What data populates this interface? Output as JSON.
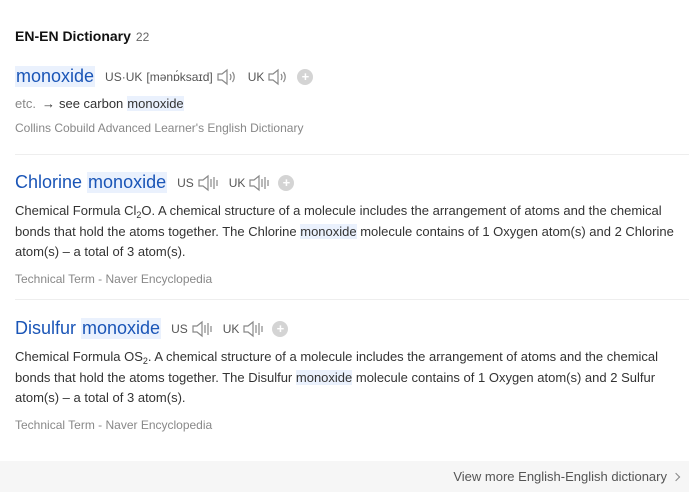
{
  "section": {
    "title": "EN-EN Dictionary",
    "count": "22"
  },
  "entries": [
    {
      "headword": "monoxide",
      "us_label": "US·UK",
      "phonetic": "[mənɒ́ksaɪd]",
      "uk_label": "UK",
      "etc_label": "etc.",
      "arrow": "→",
      "see_text": "see carbon",
      "see_hl": "monoxide",
      "source": "Collins Cobuild Advanced Learner's English Dictionary"
    },
    {
      "headword_pre": "Chlorine",
      "headword_hl": "monoxide",
      "us_label": "US",
      "uk_label": "UK",
      "def_p1": "Chemical Formula Cl",
      "def_sub": "2",
      "def_p2": "O. A chemical structure of a molecule includes the arrangement of atoms and the chemical bonds that hold the atoms together. The Chlorine ",
      "def_hl": "monoxide",
      "def_p3": " molecule contains of 1 Oxygen atom(s) and 2 Chlorine atom(s) – a total of 3 atom(s).",
      "source": "Technical Term - Naver Encyclopedia"
    },
    {
      "headword_pre": "Disulfur",
      "headword_hl": "monoxide",
      "us_label": "US",
      "uk_label": "UK",
      "def_p1": "Chemical Formula OS",
      "def_sub": "2",
      "def_p2": ". A chemical structure of a molecule includes the arrangement of atoms and the chemical bonds that hold the atoms together. The Disulfur ",
      "def_hl": "monoxide",
      "def_p3": " molecule contains of 1 Oxygen atom(s) and 2 Sulfur atom(s) – a total of 3 atom(s).",
      "source": "Technical Term - Naver Encyclopedia"
    }
  ],
  "footer": {
    "more_label": "View more English-English dictionary"
  },
  "colors": {
    "link": "#1a55b7",
    "highlight": "#eaf1fd",
    "muted": "#888888"
  },
  "icons": {
    "speaker": "speaker-icon",
    "add": "plus-icon",
    "chevron": "chevron-right-icon"
  }
}
